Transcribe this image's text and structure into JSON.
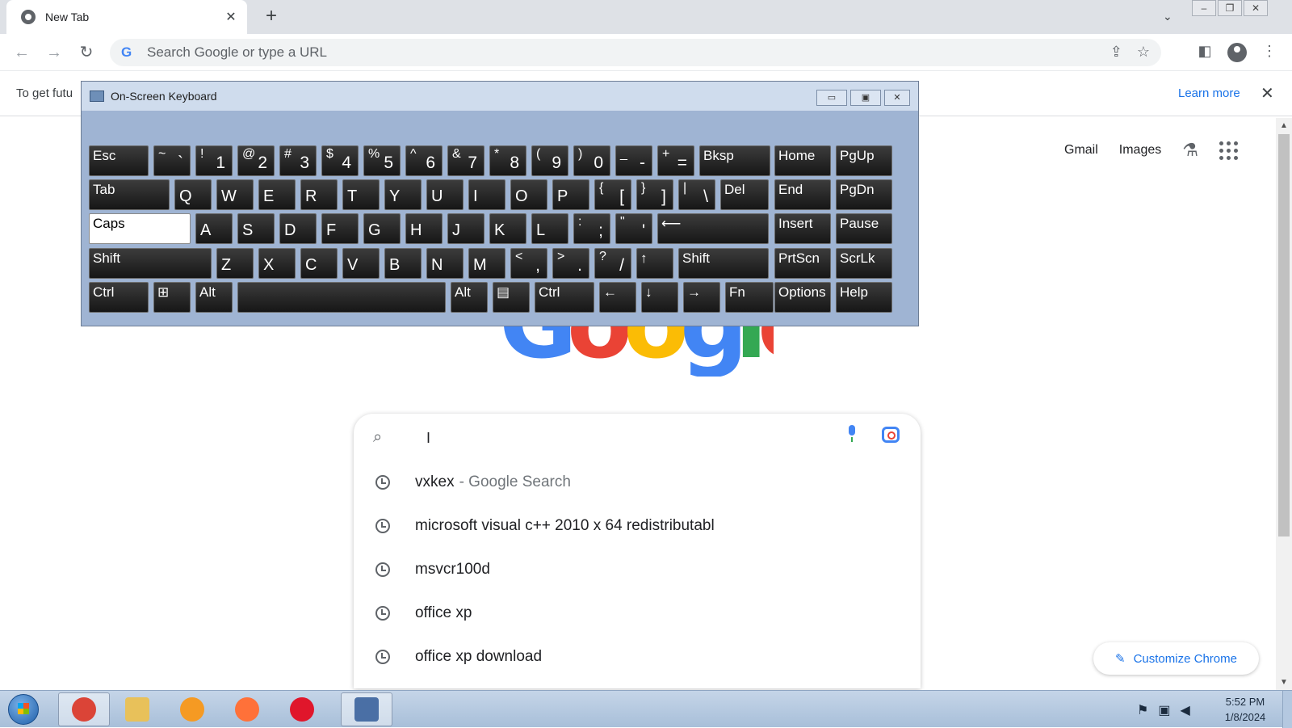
{
  "browser": {
    "tab_title": "New Tab",
    "tab_close": "✕",
    "new_tab": "+",
    "tab_list": "⌄",
    "omnibox_placeholder": "Search Google or type a URL",
    "window_controls": [
      "–",
      "❐",
      "✕"
    ]
  },
  "infobar": {
    "text": "To get futu",
    "learn_more": "Learn more",
    "close": "✕"
  },
  "ntp": {
    "links": [
      "Gmail",
      "Images"
    ],
    "logo_letters": [
      "G",
      "o",
      "o",
      "g",
      "l",
      "e"
    ],
    "logo_colors": [
      "#4285f4",
      "#ea4335",
      "#fbbc05",
      "#4285f4",
      "#34a853",
      "#ea4335"
    ],
    "search_cursor": "I",
    "suggestions": [
      {
        "text": "vxkex",
        "sub": "- Google Search"
      },
      {
        "text": "microsoft visual c++ 2010 x 64 redistributabl",
        "sub": ""
      },
      {
        "text": "msvcr100d",
        "sub": ""
      },
      {
        "text": "office xp",
        "sub": ""
      },
      {
        "text": "office xp download",
        "sub": ""
      }
    ],
    "customize": "Customize Chrome"
  },
  "osk": {
    "title": "On-Screen Keyboard",
    "controls": [
      "▭",
      "▣",
      "✕"
    ],
    "rows": [
      [
        {
          "lbl": "Esc"
        },
        {
          "top": "~",
          "bot": "`"
        },
        {
          "top": "!",
          "bot": "1"
        },
        {
          "top": "@",
          "bot": "2"
        },
        {
          "top": "#",
          "bot": "3"
        },
        {
          "top": "$",
          "bot": "4"
        },
        {
          "top": "%",
          "bot": "5"
        },
        {
          "top": "^",
          "bot": "6"
        },
        {
          "top": "&",
          "bot": "7"
        },
        {
          "top": "*",
          "bot": "8"
        },
        {
          "top": "(",
          "bot": "9"
        },
        {
          "top": ")",
          "bot": "0"
        },
        {
          "top": "_",
          "bot": "-"
        },
        {
          "top": "+",
          "bot": "="
        },
        {
          "lbl": "Bksp"
        },
        {
          "lbl": "Home"
        },
        {
          "lbl": "PgUp"
        }
      ],
      [
        {
          "lbl": "Tab"
        },
        {
          "main": "Q"
        },
        {
          "main": "W"
        },
        {
          "main": "E"
        },
        {
          "main": "R"
        },
        {
          "main": "T"
        },
        {
          "main": "Y"
        },
        {
          "main": "U"
        },
        {
          "main": "I"
        },
        {
          "main": "O"
        },
        {
          "main": "P"
        },
        {
          "top": "{",
          "bot": "["
        },
        {
          "top": "}",
          "bot": "]"
        },
        {
          "top": "|",
          "bot": "\\"
        },
        {
          "lbl": "Del"
        },
        {
          "lbl": "End"
        },
        {
          "lbl": "PgDn"
        }
      ],
      [
        {
          "lbl": "Caps"
        },
        {
          "main": "A"
        },
        {
          "main": "S"
        },
        {
          "main": "D"
        },
        {
          "main": "F"
        },
        {
          "main": "G"
        },
        {
          "main": "H"
        },
        {
          "main": "J"
        },
        {
          "main": "K"
        },
        {
          "main": "L"
        },
        {
          "top": ":",
          "bot": ";"
        },
        {
          "top": "\"",
          "bot": "'"
        },
        {
          "lbl": "⟵"
        },
        {
          "lbl": "Insert"
        },
        {
          "lbl": "Pause"
        }
      ],
      [
        {
          "lbl": "Shift"
        },
        {
          "main": "Z"
        },
        {
          "main": "X"
        },
        {
          "main": "C"
        },
        {
          "main": "V"
        },
        {
          "main": "B"
        },
        {
          "main": "N"
        },
        {
          "main": "M"
        },
        {
          "top": "<",
          "bot": ","
        },
        {
          "top": ">",
          "bot": "."
        },
        {
          "top": "?",
          "bot": "/"
        },
        {
          "lbl": "↑"
        },
        {
          "lbl": "Shift"
        },
        {
          "lbl": "PrtScn"
        },
        {
          "lbl": "ScrLk"
        }
      ],
      [
        {
          "lbl": "Ctrl"
        },
        {
          "lbl": "⊞"
        },
        {
          "lbl": "Alt"
        },
        {
          "lbl": ""
        },
        {
          "lbl": "Alt"
        },
        {
          "lbl": "▤"
        },
        {
          "lbl": "Ctrl"
        },
        {
          "lbl": "←"
        },
        {
          "lbl": "↓"
        },
        {
          "lbl": "→"
        },
        {
          "lbl": "Fn"
        },
        {
          "lbl": "Options"
        },
        {
          "lbl": "Help"
        }
      ]
    ]
  },
  "taskbar": {
    "apps": [
      {
        "name": "chrome",
        "color": "#db4437",
        "active": true
      },
      {
        "name": "explorer",
        "color": "#e8c15a",
        "active": false
      },
      {
        "name": "media-player",
        "color": "#f59a23",
        "active": false
      },
      {
        "name": "firefox",
        "color": "#ff7139",
        "active": false
      },
      {
        "name": "opera",
        "color": "#e0162b",
        "active": false
      },
      {
        "name": "on-screen-keyboard",
        "color": "#4a6fa5",
        "active": true
      }
    ],
    "time": "5:52 PM",
    "date": "1/8/2024"
  }
}
